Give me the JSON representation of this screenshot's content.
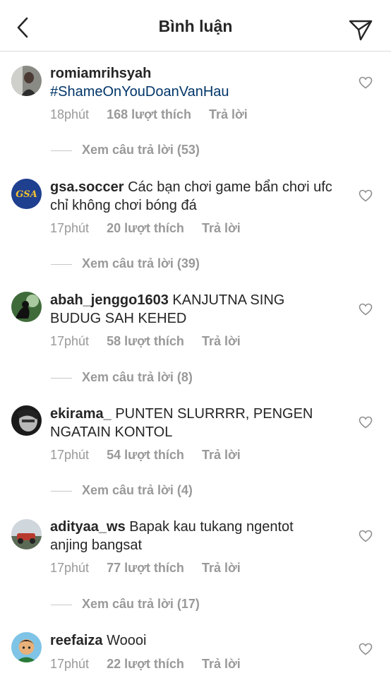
{
  "header": {
    "title": "Bình luận"
  },
  "colors": {
    "text": "#262626",
    "muted": "#999999",
    "hashtag": "#003569",
    "divider": "#dbdbdb"
  },
  "icons": {
    "back": "chevron-left-icon",
    "send": "paper-plane-icon",
    "like": "heart-outline-icon"
  },
  "comments": [
    {
      "username": "romiamrihsyah",
      "text": "",
      "hashtag": "#ShameOnYouDoanVanHau",
      "time": "18phút",
      "likes": "168 lượt thích",
      "reply": "Trả lời",
      "view_replies": "Xem câu trả lời (53)"
    },
    {
      "username": "gsa.soccer",
      "text": "Các bạn chơi game bẩn chơi ufc chỉ không chơi bóng đá",
      "time": "17phút",
      "likes": "20 lượt thích",
      "reply": "Trả lời",
      "view_replies": "Xem câu trả lời (39)"
    },
    {
      "username": "abah_jenggo1603",
      "text": "KANJUTNA SING BUDUG SAH KEHED",
      "time": "17phút",
      "likes": "58 lượt thích",
      "reply": "Trả lời",
      "view_replies": "Xem câu trả lời (8)"
    },
    {
      "username": "ekirama_",
      "text": "PUNTEN SLURRRR, PENGEN NGATAIN KONTOL",
      "time": "17phút",
      "likes": "54 lượt thích",
      "reply": "Trả lời",
      "view_replies": "Xem câu trả lời (4)"
    },
    {
      "username": "adityaa_ws",
      "text": "Bapak kau tukang ngentot anjing bangsat",
      "time": "17phút",
      "likes": "77 lượt thích",
      "reply": "Trả lời",
      "view_replies": "Xem câu trả lời (17)"
    },
    {
      "username": "reefaiza",
      "text": "Woooi",
      "time": "17phút",
      "likes": "22 lượt thích",
      "reply": "Trả lời"
    }
  ]
}
